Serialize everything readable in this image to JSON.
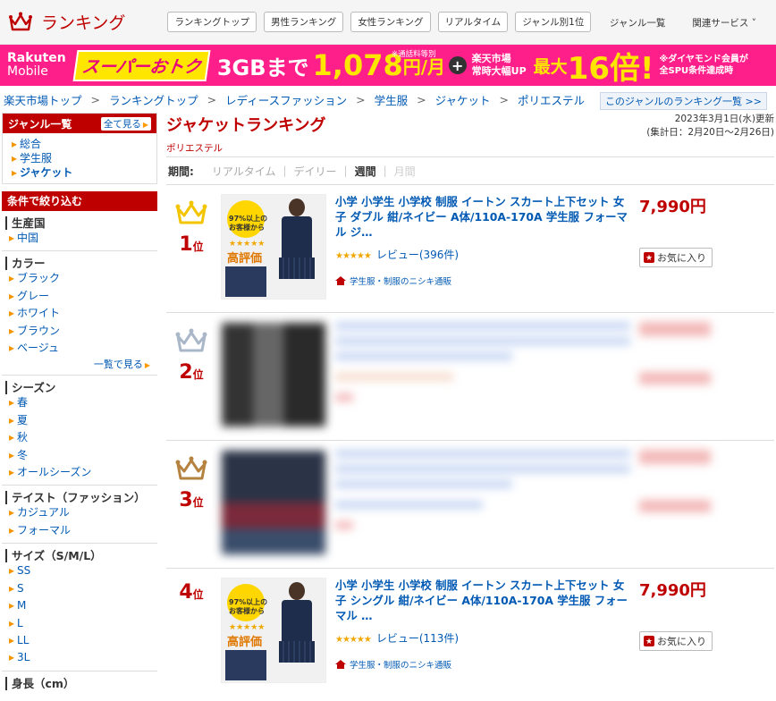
{
  "header": {
    "title": "ランキング",
    "tabs": [
      "ランキングトップ",
      "男性ランキング",
      "女性ランキング",
      "リアルタイム",
      "ジャンル別1位"
    ],
    "links": [
      "ジャンル一覧",
      "関連サービス ˅"
    ]
  },
  "banner": {
    "brand_line1": "Rakuten",
    "brand_line2": "Mobile",
    "sale": "スーパーおトク",
    "data": "3GBまで",
    "price": "1,078",
    "unit": "円/月",
    "price_note": "※通話料等別",
    "plus": "+",
    "ichiba_line1": "楽天市場",
    "ichiba_line2": "常時大幅UP",
    "max": "最大",
    "multiplier": "16倍!",
    "diamond_line1": "※ダイヤモンド会員が",
    "diamond_line2": "全SPU条件達成時"
  },
  "breadcrumb": {
    "items": [
      "楽天市場トップ",
      "ランキングトップ",
      "レディースファッション",
      "学生服",
      "ジャケット",
      "ポリエステル"
    ],
    "separator": ">",
    "genre_list_link": "このジャンルのランキング一覧 >>"
  },
  "sidebar": {
    "genre_title": "ジャンル一覧",
    "see_all": "全て見る",
    "genres": [
      "総合",
      "学生服",
      "ジャケット"
    ],
    "filter_title": "条件で絞り込む",
    "groups": [
      {
        "title": "生産国",
        "items": [
          "中国"
        ]
      },
      {
        "title": "カラー",
        "items": [
          "ブラック",
          "グレー",
          "ホワイト",
          "ブラウン",
          "ベージュ"
        ],
        "more": "一覧で見る"
      },
      {
        "title": "シーズン",
        "items": [
          "春",
          "夏",
          "秋",
          "冬",
          "オールシーズン"
        ]
      },
      {
        "title": "テイスト（ファッション）",
        "items": [
          "カジュアル",
          "フォーマル"
        ]
      },
      {
        "title": "サイズ（S/M/L）",
        "items": [
          "SS",
          "S",
          "M",
          "L",
          "LL",
          "3L"
        ]
      },
      {
        "title": "身長（cm）",
        "items": []
      }
    ]
  },
  "content": {
    "title": "ジャケットランキング",
    "subtitle": "ポリエステル",
    "updated": "2023年3月1日(水)更新",
    "period_range": "(集計日：2月20日～2月26日)",
    "period_label": "期間:",
    "periods": [
      "リアルタイム",
      "デイリー",
      "週間",
      "月間"
    ],
    "active_period": "週間",
    "rank_suffix": "位",
    "items": [
      {
        "rank": "1",
        "name": "小学 小学生 小学校 制服 イートン スカート上下セット 女子 ダブル 紺/ネイビー A体/110A-170A 学生服 フォーマル ジ…",
        "review": "レビュー(396件)",
        "shop": "学生服・制服のニシキ通販",
        "price": "7,990円",
        "fav": "お気に入り",
        "thumb_line1": "97%以上の",
        "thumb_line2": "お客様から",
        "thumb_line3": "高評価",
        "crown_color": "#f2c500",
        "blurred": false
      },
      {
        "rank": "2",
        "crown_color": "#a9b7c8",
        "blurred": true
      },
      {
        "rank": "3",
        "crown_color": "#b5833f",
        "blurred": true
      },
      {
        "rank": "4",
        "name": "小学 小学生 小学校 制服 イートン スカート上下セット 女子 シングル 紺/ネイビー A体/110A-170A 学生服 フォーマル …",
        "review": "レビュー(113件)",
        "shop": "学生服・制服のニシキ通販",
        "price": "7,990円",
        "fav": "お気に入り",
        "thumb_line1": "97%以上の",
        "thumb_line2": "お客様から",
        "thumb_line3": "高評価",
        "blurred": false
      }
    ],
    "stars": "★★★★★"
  },
  "colors": {
    "accent": "#bf0000",
    "link": "#0059b3",
    "banner": "#ff1f8a",
    "banner_yellow": "#ffe600"
  }
}
